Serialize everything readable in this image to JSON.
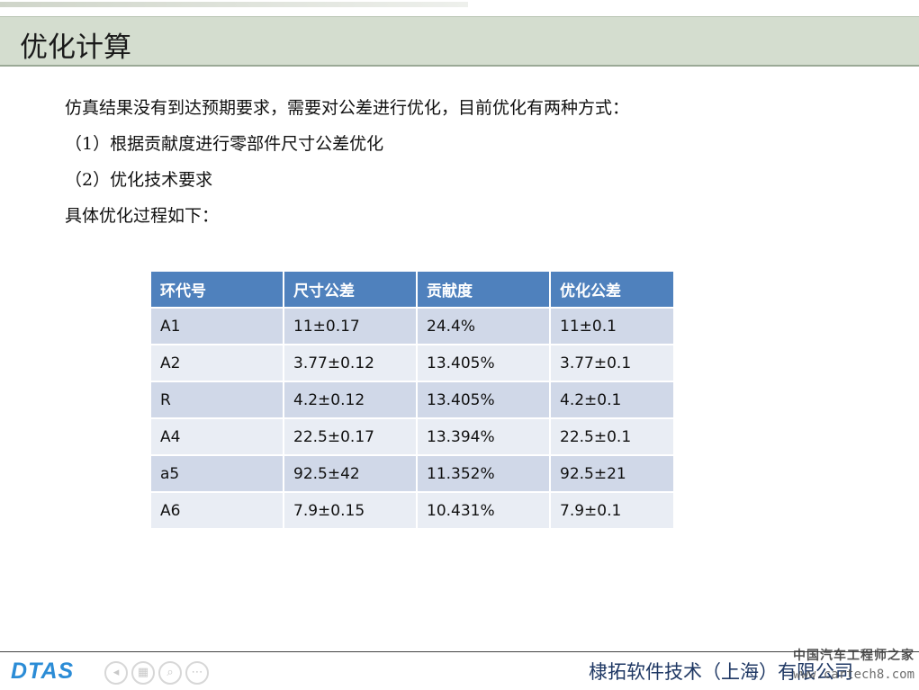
{
  "header": {
    "title": "优化计算"
  },
  "content": {
    "paragraphs": [
      "仿真结果没有到达预期要求，需要对公差进行优化，目前优化有两种方式：",
      "（1）根据贡献度进行零部件尺寸公差优化",
      "（2）优化技术要求",
      "具体优化过程如下："
    ]
  },
  "table": {
    "headers": [
      "环代号",
      "尺寸公差",
      "贡献度",
      "优化公差"
    ],
    "rows": [
      [
        "A1",
        "11±0.17",
        "24.4%",
        "11±0.1"
      ],
      [
        "A2",
        "3.77±0.12",
        "13.405%",
        "3.77±0.1"
      ],
      [
        "R",
        "4.2±0.12",
        "13.405%",
        "4.2±0.1"
      ],
      [
        "A4",
        "22.5±0.17",
        "13.394%",
        "22.5±0.1"
      ],
      [
        "a5",
        "92.5±42",
        "11.352%",
        "92.5±21"
      ],
      [
        "A6",
        "7.9±0.15",
        "10.431%",
        "7.9±0.1"
      ]
    ],
    "header_color": "#4f81bd",
    "row_color_odd": "#d0d8e8",
    "row_color_even": "#e9edf4"
  },
  "footer": {
    "logo_text": "DTAS",
    "company": "棣拓软件技术（上海）有限公司",
    "watermark_cn": "中国汽车工程师之家",
    "watermark_url": "www.cartech8.com",
    "nav_icons": [
      "back-icon",
      "grid-icon",
      "zoom-icon",
      "more-icon"
    ]
  }
}
